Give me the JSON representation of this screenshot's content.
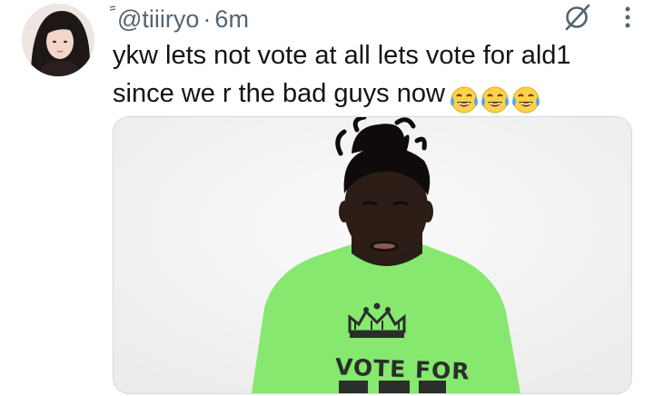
{
  "tweet": {
    "handle": "@tiiiryo",
    "separator": "·",
    "time": "6m",
    "text_line1": "ykw lets not vote at all lets vote for ald1",
    "text_line2": "since we r the bad guys now",
    "emoji": [
      "face-with-tears-of-joy",
      "face-with-tears-of-joy",
      "face-with-tears-of-joy"
    ]
  },
  "media": {
    "shirt_text": "VOTE FOR"
  },
  "icons": {
    "grok": "slashed-circle-icon",
    "more": "more-vertical-icon"
  },
  "colors": {
    "text": "#0f1419",
    "secondary": "#536471",
    "shirt": "#86e86f"
  }
}
